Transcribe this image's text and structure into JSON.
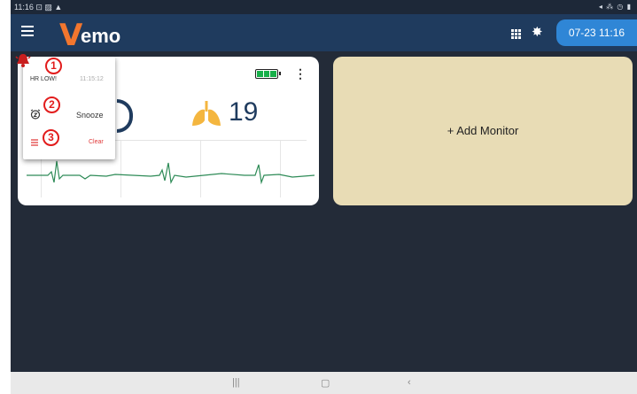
{
  "status_bar": {
    "time": "11:16",
    "left_icons": "⊡ ▨ ▲",
    "right_icons": "◂ ⁂ ◷ ▮"
  },
  "app_bar": {
    "logo_v": "V",
    "logo_rest": "emo",
    "datetime": "07-23 11:16"
  },
  "monitor": {
    "resp_rate": "19",
    "battery_level": 1.0
  },
  "alarm_popup": {
    "alarm_label": "HR LOW!",
    "alarm_time": "11:15:12",
    "snooze_label": "Snooze",
    "clear_label": "Clear"
  },
  "annotations": [
    "1",
    "2",
    "3"
  ],
  "add_monitor": {
    "label": "+ Add Monitor"
  },
  "nav_bar": {
    "recents": "|||",
    "home": "▢",
    "back": "‹"
  },
  "colors": {
    "brand_orange": "#f2762e",
    "app_bar": "#1f3b5e",
    "accent_blue": "#2f86d6",
    "alarm_red": "#e21c1c",
    "add_card": "#e8dcb5",
    "ecg_green": "#2e8b57"
  }
}
